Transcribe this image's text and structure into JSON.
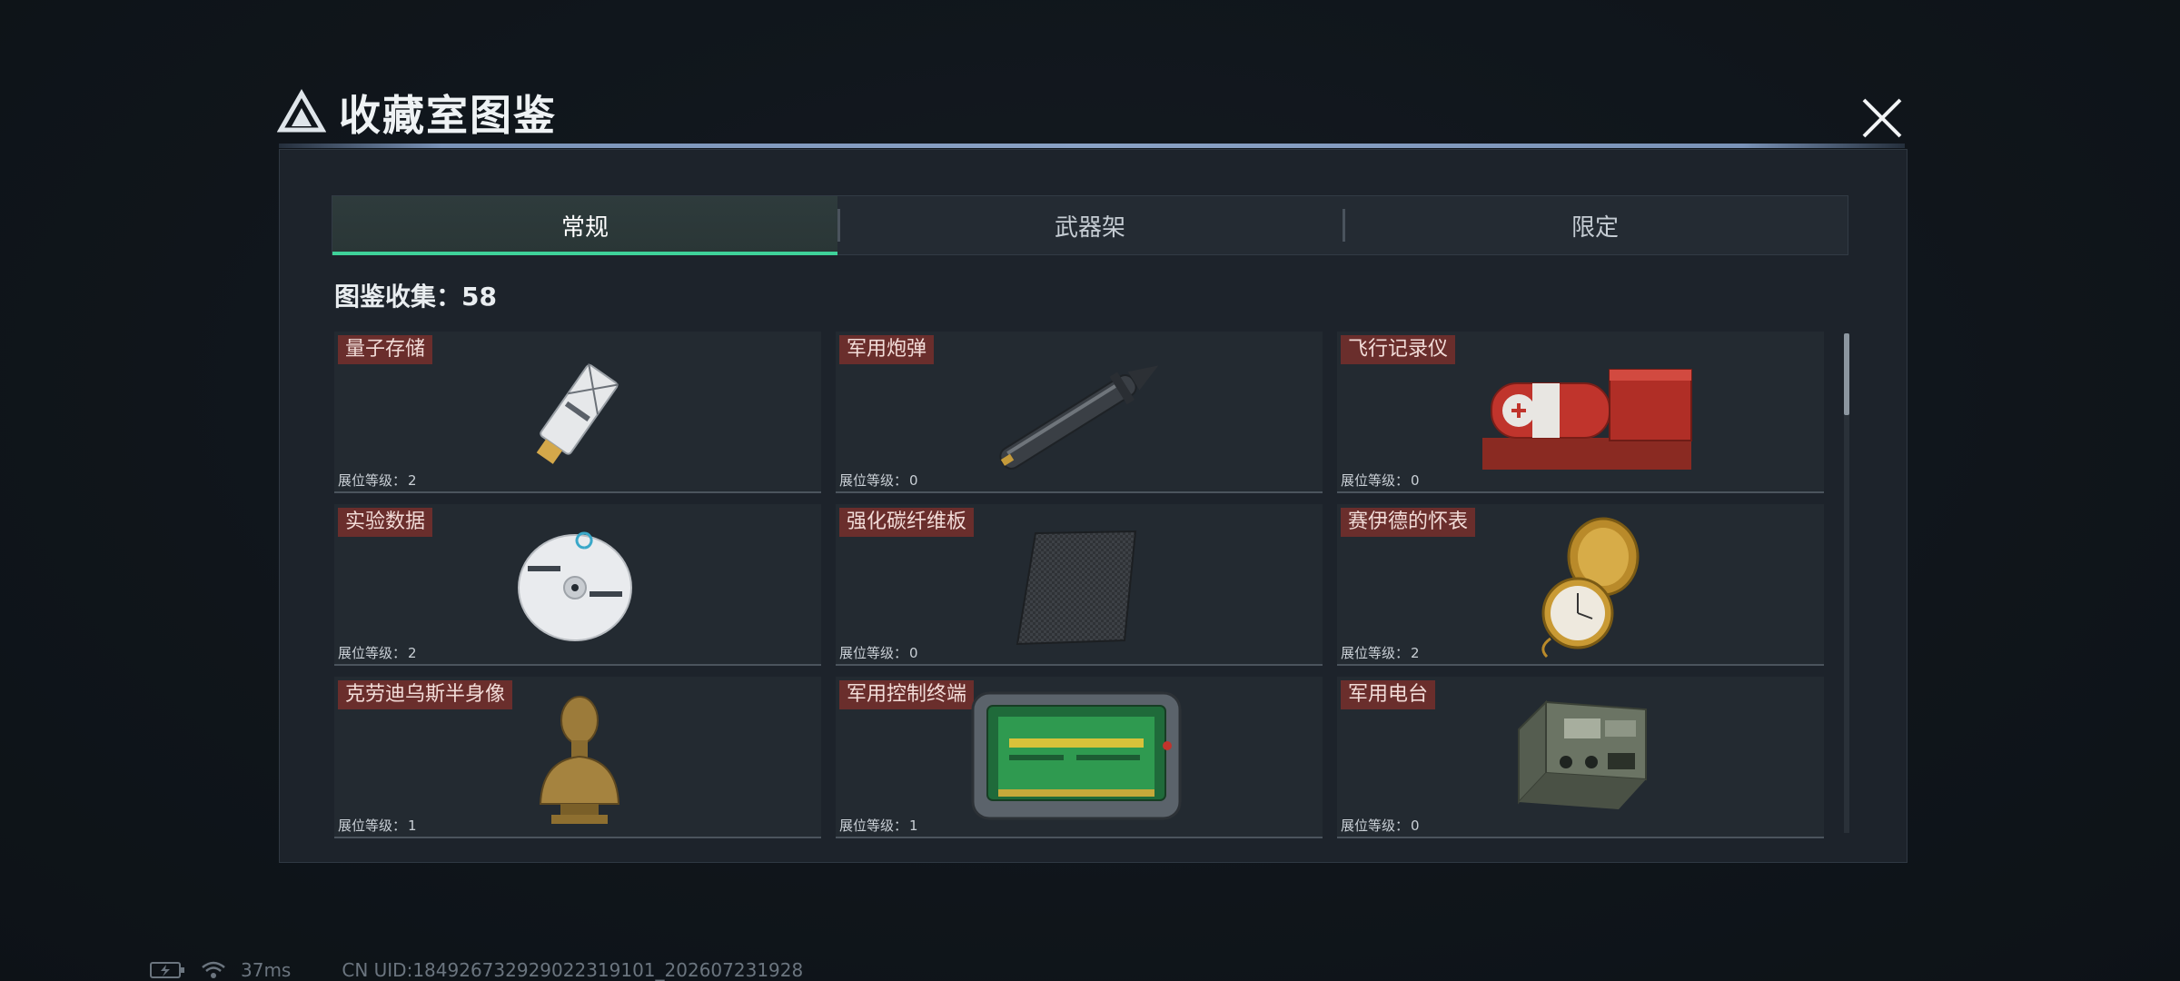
{
  "header": {
    "title": "收藏室图鉴"
  },
  "tabs": [
    {
      "label": "常规",
      "active": true
    },
    {
      "label": "武器架",
      "active": false
    },
    {
      "label": "限定",
      "active": false
    }
  ],
  "collection": {
    "label": "图鉴收集：",
    "count": "58"
  },
  "level_label": "展位等级：",
  "items": [
    {
      "name": "量子存储",
      "level": "2",
      "icon": "usb-drive-icon"
    },
    {
      "name": "军用炮弹",
      "level": "0",
      "icon": "artillery-shell-icon"
    },
    {
      "name": "飞行记录仪",
      "level": "0",
      "icon": "flight-recorder-icon"
    },
    {
      "name": "实验数据",
      "level": "2",
      "icon": "data-disc-icon"
    },
    {
      "name": "强化碳纤维板",
      "level": "0",
      "icon": "carbon-plate-icon"
    },
    {
      "name": "赛伊德的怀表",
      "level": "2",
      "icon": "pocket-watch-icon"
    },
    {
      "name": "克劳迪乌斯半身像",
      "level": "1",
      "icon": "bust-statue-icon"
    },
    {
      "name": "军用控制终端",
      "level": "1",
      "icon": "control-terminal-icon"
    },
    {
      "name": "军用电台",
      "level": "0",
      "icon": "military-radio-icon"
    }
  ],
  "status": {
    "ping": "37ms",
    "uid": "CN UID:184926732929022319101_202607231928"
  },
  "colors": {
    "accent": "#3fd29a",
    "name_tag": "#6a2e2c",
    "panel": "#1d232b"
  }
}
